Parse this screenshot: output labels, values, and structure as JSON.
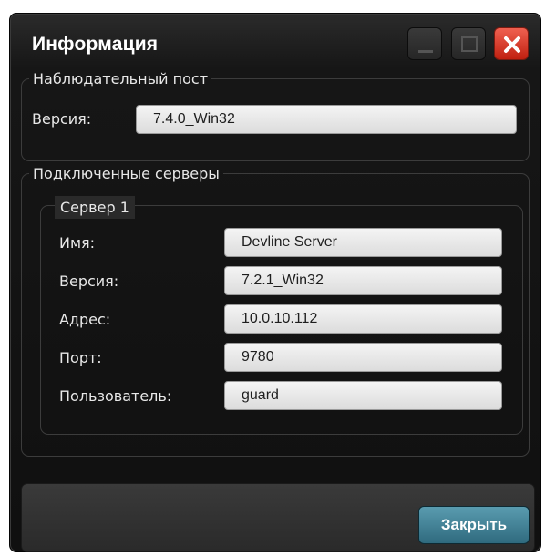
{
  "window": {
    "title": "Информация"
  },
  "observation_post": {
    "legend": "Наблюдательный пост",
    "version_label": "Версия:",
    "version_value": "7.4.0_Win32"
  },
  "servers": {
    "legend": "Подключенные серверы",
    "server1": {
      "legend": "Сервер 1",
      "name_label": "Имя:",
      "name_value": "Devline Server",
      "version_label": "Версия:",
      "version_value": "7.2.1_Win32",
      "address_label": "Адрес:",
      "address_value": "10.0.10.112",
      "port_label": "Порт:",
      "port_value": "9780",
      "user_label": "Пользователь:",
      "user_value": "guard"
    }
  },
  "footer": {
    "close_label": "Закрыть"
  },
  "colors": {
    "close_accent": "#d83020",
    "button_accent": "#3f7f93"
  }
}
